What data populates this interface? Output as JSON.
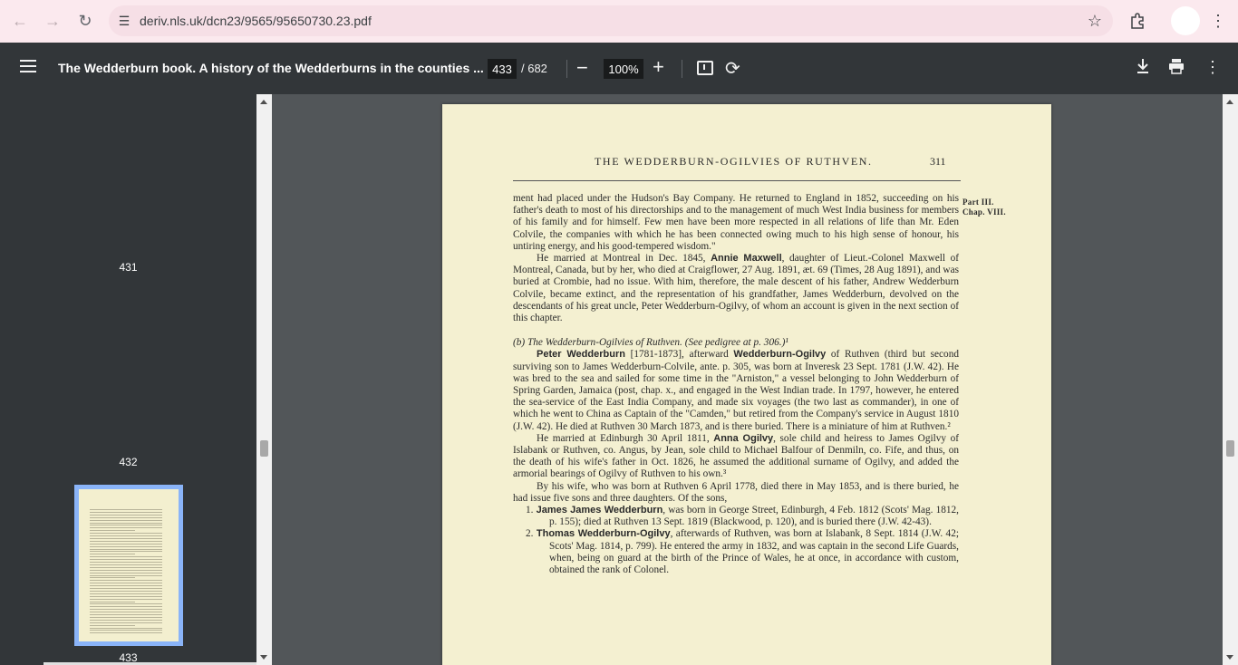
{
  "browser": {
    "url": "deriv.nls.uk/dcn23/9565/95650730.23.pdf"
  },
  "toolbar": {
    "title": "The Wedderburn book. A history of the Wedderburns in the counties ...",
    "current_page": "433",
    "total_pages": "/ 682",
    "zoom": "100%"
  },
  "sidebar": {
    "thumbs": [
      "431",
      "432",
      "433"
    ],
    "selected": "433"
  },
  "page": {
    "running_head": "THE WEDDERBURN-OGILVIES OF RUTHVEN.",
    "page_number": "311",
    "margin_part": "Part III.",
    "margin_chap": "Chap. VIII.",
    "p1": "ment had placed under the Hudson's Bay Company. He returned to England in 1852, succeeding on his father's death to most of his directorships and to the management of much West India business for members of his family and for himself. Few men have been more respected in all relations of life than Mr. Eden Colvile, the companies with which he has been connected owing much to his high sense of honour, his untiring energy, and his good-tempered wisdom.\"",
    "p2_pre": "He married at Montreal in Dec. 1845,",
    "p2_name": "Annie Maxwell",
    "p2_post": ", daughter of Lieut.-Colonel Maxwell of Montreal, Canada, but by her, who died at Craigflower, 27 Aug. 1891, æt. 69 (Times, 28 Aug 1891), and was buried at Crombie, had no issue. With him, therefore, the male descent of his father, Andrew Wedderburn Colvile, became extinct, and the representation of his grandfather, James Wedderburn, devolved on the descendants of his great uncle, Peter Wedderburn-Ogilvy, of whom an account is given in the next section of this chapter.",
    "section_heading": "(b) The Wedderburn-Ogilvies of Ruthven. (See pedigree at p. 306.)¹",
    "p3_name1": "Peter Wedderburn",
    "p3_mid": " [1781-1873], afterward ",
    "p3_name2": "Wedderburn-Ogilvy",
    "p3_post": " of Ruthven (third but second surviving son to James Wedderburn-Colvile, ante. p. 305, was born at Inveresk 23 Sept. 1781 (J.W. 42). He was bred to the sea and sailed for some time in the \"Arniston,\" a vessel belonging to John Wedderburn of Spring Garden, Jamaica (post, chap. x., and engaged in the West Indian trade. In 1797, however, he entered the sea-service of the East India Company, and made six voyages (the two last as commander), in one of which he went to China as Captain of the \"Camden,\" but retired from the Company's service in August 1810 (J.W. 42). He died at Ruthven 30 March 1873, and is there buried. There is a miniature of him at Ruthven.²",
    "p4_pre": "He married at Edinburgh 30 April 1811,",
    "p4_name": "Anna Ogilvy",
    "p4_post": ", sole child and heiress to James Ogilvy of Islabank or Ruthven, co. Angus, by Jean, sole child to Michael Balfour of Denmiln, co. Fife, and thus, on the death of his wife's father in Oct. 1826, he assumed the additional surname of Ogilvy, and added the armorial bearings of Ogilvy of Ruthven to his own.³",
    "p5": "By his wife, who was born at Ruthven 6 April 1778, died there in May 1853, and is there buried, he had issue five sons and three daughters. Of the sons,",
    "item1_num": "1.",
    "item1_name": "James James Wedderburn",
    "item1_post": ", was born in George Street, Edinburgh, 4 Feb. 1812 (Scots' Mag. 1812, p. 155); died at Ruthven 13 Sept. 1819 (Blackwood, p. 120), and is buried there (J.W. 42-43).",
    "item2_num": "2.",
    "item2_name": "Thomas Wedderburn-Ogilvy",
    "item2_post": ", afterwards of Ruthven, was born at Islabank, 8 Sept. 1814 (J.W. 42; Scots' Mag. 1814, p. 799). He entered the army in 1832, and was captain in the second Life Guards, when, being on guard at the birth of the Prince of Wales, he at once, in accordance with custom, obtained the rank of Colonel."
  }
}
